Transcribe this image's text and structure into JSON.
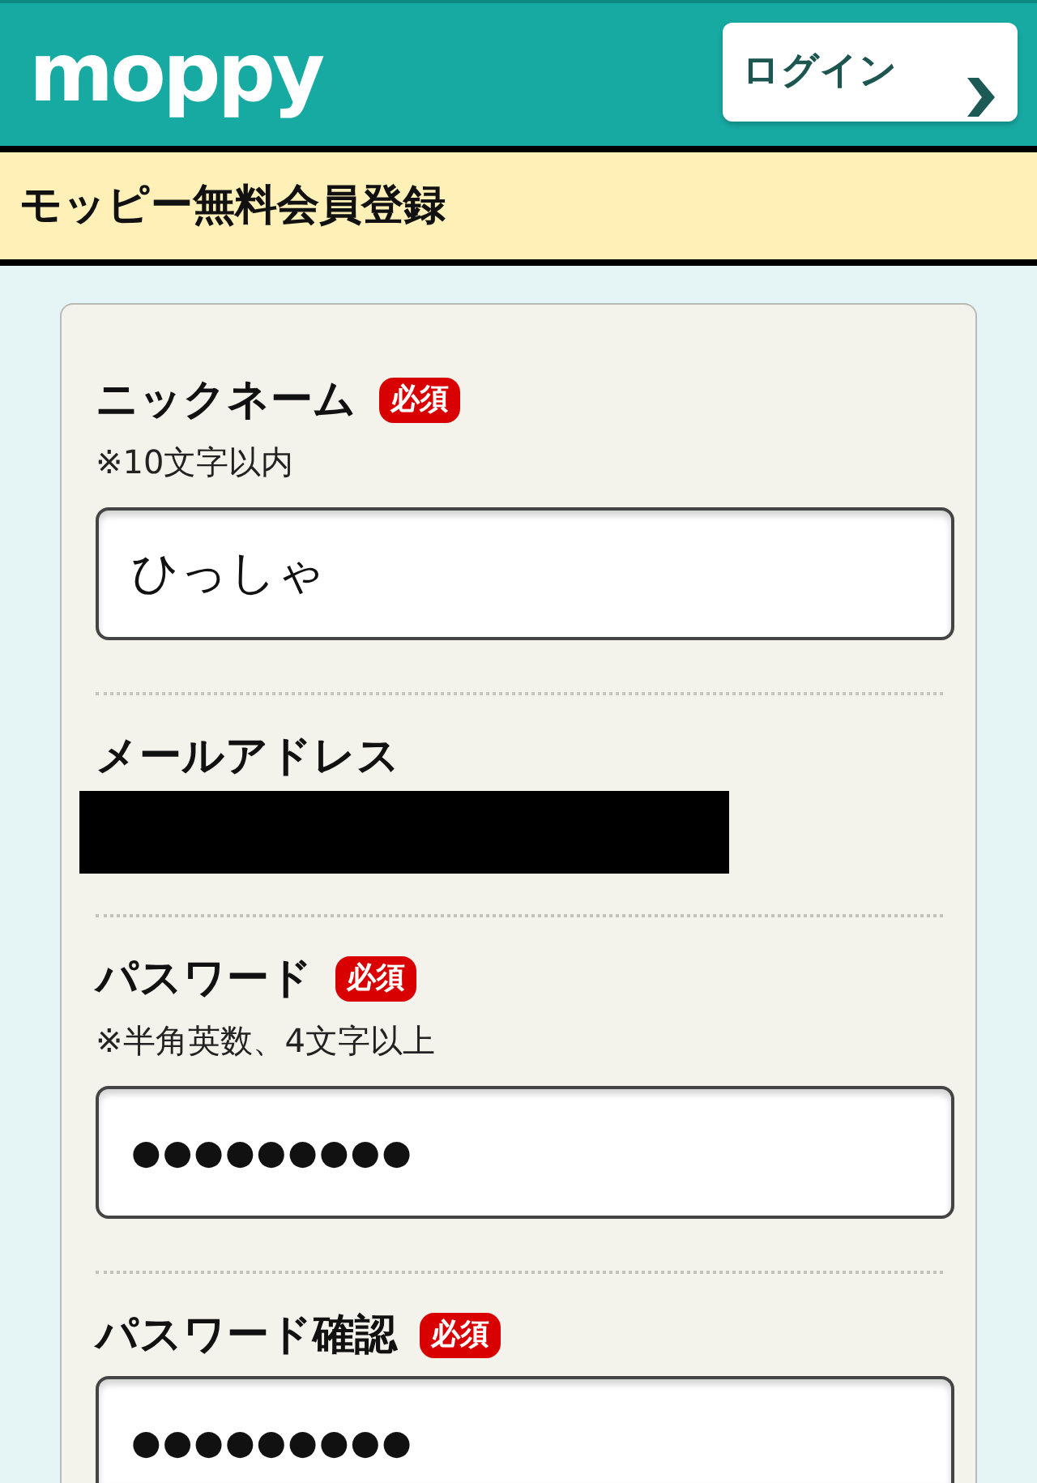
{
  "header": {
    "logo": "moppy",
    "login_button": "ログイン"
  },
  "page_title": "モッピー無料会員登録",
  "form": {
    "fields": [
      {
        "kind": "text",
        "label": "ニックネーム",
        "required": true,
        "badge": "必須",
        "hint": "※10文字以内",
        "value": "ひっしゃ"
      },
      {
        "kind": "redacted",
        "label": "メールアドレス",
        "required": false
      },
      {
        "kind": "password",
        "label": "パスワード",
        "required": true,
        "badge": "必須",
        "hint": "※半角英数、4文字以上",
        "value": "●●●●●●●●●"
      },
      {
        "kind": "password",
        "label": "パスワード確認",
        "required": true,
        "badge": "必須",
        "value": "●●●●●●●●●"
      }
    ]
  }
}
